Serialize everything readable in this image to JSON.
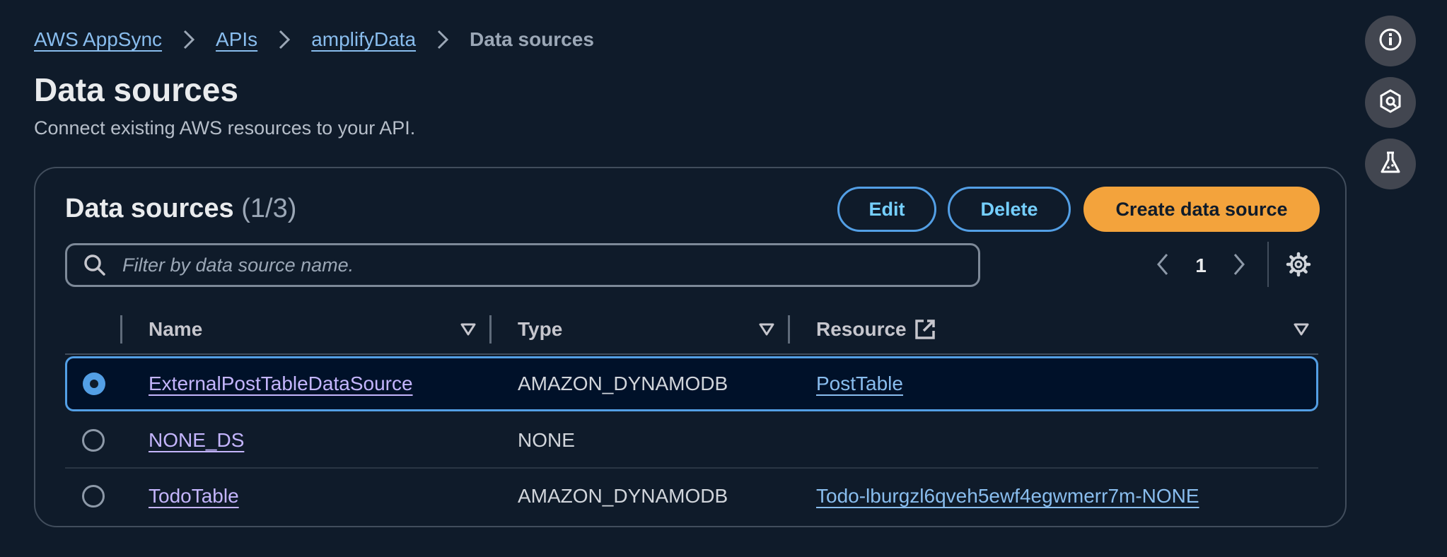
{
  "breadcrumb": {
    "items": [
      "AWS AppSync",
      "APIs",
      "amplifyData"
    ],
    "current": "Data sources"
  },
  "page": {
    "title": "Data sources",
    "description": "Connect existing AWS resources to your API."
  },
  "rail": {
    "icons": [
      "info-icon",
      "hexagon-q-icon",
      "flask-icon"
    ]
  },
  "panel": {
    "title": "Data sources",
    "count": "(1/3)",
    "edit_label": "Edit",
    "delete_label": "Delete",
    "create_label": "Create data source"
  },
  "search": {
    "placeholder": "Filter by data source name.",
    "value": ""
  },
  "pagination": {
    "current_page": "1"
  },
  "table": {
    "columns": [
      "Name",
      "Type",
      "Resource"
    ],
    "rows": [
      {
        "name": "ExternalPostTableDataSource",
        "type": "AMAZON_DYNAMODB",
        "resource": "PostTable",
        "selected": true
      },
      {
        "name": "NONE_DS",
        "type": "NONE",
        "resource": "",
        "selected": false
      },
      {
        "name": "TodoTable",
        "type": "AMAZON_DYNAMODB",
        "resource": "Todo-lburgzl6qveh5ewf4egwmerr7m-NONE",
        "selected": false
      }
    ]
  },
  "colors": {
    "background": "#0f1b2a",
    "link": "#89bdee",
    "visited_link": "#c4b5fd",
    "primary_button": "#f3a33c",
    "selected_border": "#539fe5"
  }
}
